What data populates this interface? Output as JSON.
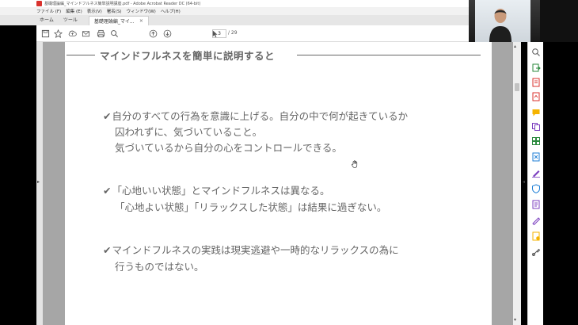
{
  "window": {
    "title": "基礎理論編_マインドフルネス簡単説明講座.pdf - Adobe Acrobat Reader DC (64-bit)"
  },
  "menubar": {
    "items": [
      "ファイル (F)",
      "編集 (E)",
      "表示(V)",
      "署名(S)",
      "ウィンドウ(W)",
      "ヘルプ(H)"
    ]
  },
  "tabs": {
    "home": "ホーム",
    "tools": "ツール",
    "document": "基礎理論編_マイ...",
    "close": "×"
  },
  "toolbar": {
    "page_current": "3",
    "page_total": "/ 29",
    "zoom": "100%",
    "zoom_arrow": "▾"
  },
  "scroll": {
    "up": "▴",
    "down": "▾",
    "left_toggle": "▸",
    "right_toggle": "◂"
  },
  "slide": {
    "heading": "マインドフルネスを簡単に説明すると",
    "check": "✔",
    "bullets": [
      {
        "lines": [
          "自分のすべての行為を意識に上げる。自分の中で何が起きているか",
          "囚われずに、気づいていること。",
          "気づいているから自分の心をコントロールできる。"
        ]
      },
      {
        "lines": [
          "「心地いい状態」とマインドフルネスは異なる。",
          "「心地よい状態」「リラックスした状態」は結果に過ぎない。"
        ]
      },
      {
        "lines": [
          "マインドフルネスの実践は現実逃避や一時的なリラックスの為に",
          "行うものではない。"
        ]
      }
    ]
  },
  "colors": {
    "page_bg": "#a6a6a6",
    "slide_text": "#666666",
    "acrobat_red": "#d9322d",
    "tool_purple": "#7b3fbf"
  },
  "icons": {
    "toolbar": [
      "save-icon",
      "bookmark-icon",
      "upload-icon",
      "mail-icon",
      "print-icon",
      "search-icon",
      "page-up-icon",
      "page-down-icon",
      "select-cursor-icon",
      "hand-icon",
      "zoom-out-icon",
      "zoom-in-icon",
      "fit-page-icon",
      "scroll-mode-icon",
      "comment-icon",
      "pen-icon",
      "highlighter-icon",
      "stamp-icon",
      "delete-icon",
      "share-icon"
    ],
    "right_pane": [
      "zoom-icon",
      "export-pdf-icon",
      "edit-pdf-icon",
      "create-pdf-icon",
      "comment-icon",
      "combine-icon",
      "organize-icon",
      "compress-icon",
      "fill-sign-icon",
      "protect-icon",
      "scan-icon",
      "redact-icon",
      "send-icon",
      "more-tools-icon"
    ]
  }
}
